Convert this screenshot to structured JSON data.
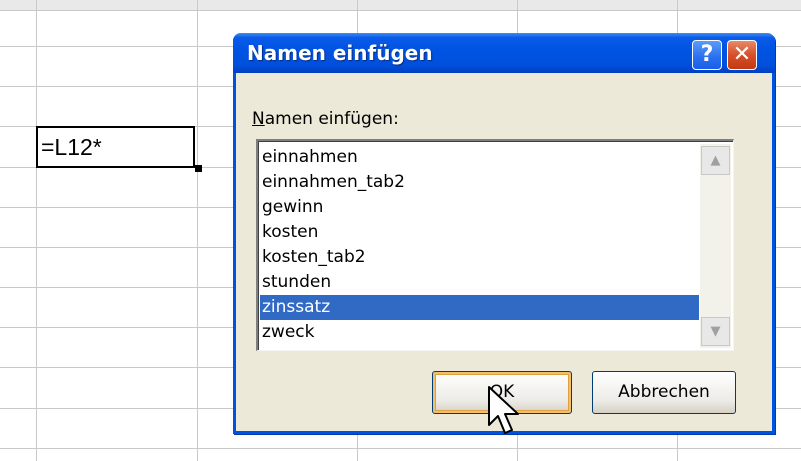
{
  "sheet": {
    "active_cell_value": "=L12*"
  },
  "dialog": {
    "title": "Namen einfügen",
    "help_button": "?",
    "close_button": "✕",
    "list_label_accel": "N",
    "list_label_rest": "amen einfügen:",
    "items": [
      {
        "label": "einnahmen"
      },
      {
        "label": "einnahmen_tab2"
      },
      {
        "label": "gewinn"
      },
      {
        "label": "kosten"
      },
      {
        "label": "kosten_tab2"
      },
      {
        "label": "stunden"
      },
      {
        "label": "zinssatz",
        "selected": true
      },
      {
        "label": "zweck"
      }
    ],
    "scroll_up": "▲",
    "scroll_down": "▼",
    "ok_label": "OK",
    "cancel_label": "Abbrechen"
  },
  "icons": {
    "help": "question-mark-icon",
    "close": "close-icon",
    "cursor": "mouse-pointer-icon"
  },
  "colors": {
    "titlebar": "#0054e3",
    "selection": "#316ac5",
    "dialog_bg": "#ece9d8",
    "close_button": "#d6502a"
  }
}
